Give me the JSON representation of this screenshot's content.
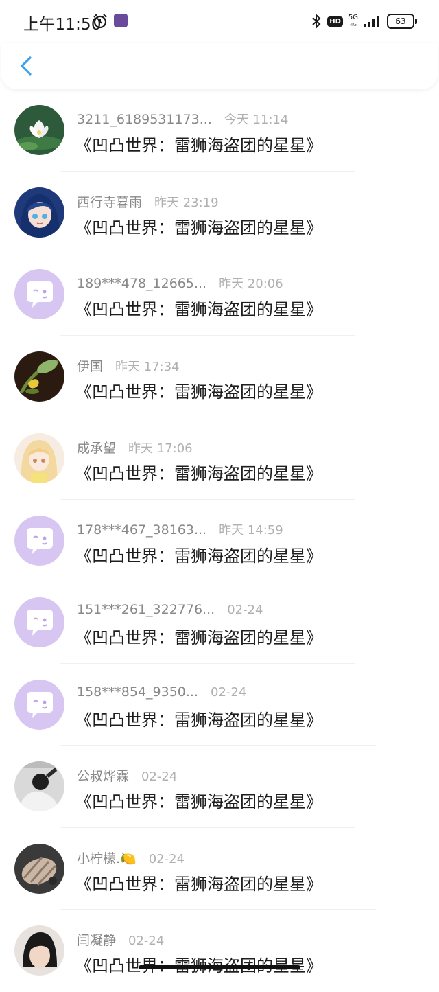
{
  "status_bar": {
    "time": "上午11:50",
    "network": "5G",
    "network_sub": "4G",
    "hd": "HD",
    "battery": "63"
  },
  "nav": {
    "back_icon": "chevron-left-icon",
    "accent_color": "#3aa0f0"
  },
  "messages": [
    {
      "name": "3211_6189531173...",
      "time": "今天 11:14",
      "text": "《凹凸世界：雷狮海盗团的星星》",
      "avatar": "lotus-photo"
    },
    {
      "name": "西行寺暮雨",
      "time": "昨天 23:19",
      "text": "《凹凸世界：雷狮海盗团的星星》",
      "avatar": "anime-blue-hair"
    },
    {
      "name": "189***478_12665...",
      "time": "昨天 20:06",
      "text": "《凹凸世界：雷狮海盗团的星星》",
      "avatar": "default-chat-bubble"
    },
    {
      "name": "伊国",
      "time": "昨天 17:34",
      "text": "《凹凸世界：雷狮海盗团的星星》",
      "avatar": "plant-photo"
    },
    {
      "name": "成承望",
      "time": "昨天 17:06",
      "text": "《凹凸世界：雷狮海盗团的星星》",
      "avatar": "anime-blonde"
    },
    {
      "name": "178***467_38163...",
      "time": "昨天 14:59",
      "text": "《凹凸世界：雷狮海盗团的星星》",
      "avatar": "default-chat-bubble"
    },
    {
      "name": "151***261_322776...",
      "time": "02-24",
      "text": "《凹凸世界：雷狮海盗团的星星》",
      "avatar": "default-chat-bubble"
    },
    {
      "name": "158***854_9350...",
      "time": "02-24",
      "text": "《凹凸世界：雷狮海盗团的星星》",
      "avatar": "default-chat-bubble"
    },
    {
      "name": "公叔烨霖",
      "time": "02-24",
      "text": "《凹凸世界：雷狮海盗团的星星》",
      "avatar": "bw-photo"
    },
    {
      "name": "小柠檬.🍋",
      "time": "02-24",
      "text": "《凹凸世界：雷狮海盗团的星星》",
      "avatar": "hand-photo"
    },
    {
      "name": "闫凝静",
      "time": "02-24",
      "text": "《凹凸世界：雷狮海盗团的星星》",
      "avatar": "person-photo"
    }
  ]
}
